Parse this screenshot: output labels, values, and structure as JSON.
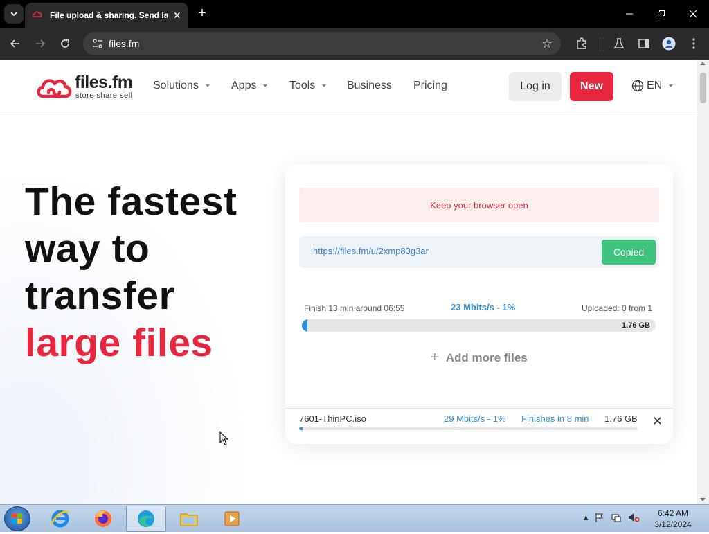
{
  "browser": {
    "tab_title": "File upload & sharing. Send large files",
    "tab_close": "✕",
    "new_tab": "+",
    "url": "files.fm"
  },
  "site": {
    "logo_name": "files.fm",
    "logo_tagline": "store share sell",
    "nav": [
      {
        "label": "Solutions",
        "has_dropdown": true
      },
      {
        "label": "Apps",
        "has_dropdown": true
      },
      {
        "label": "Tools",
        "has_dropdown": true
      },
      {
        "label": "Business",
        "has_dropdown": false
      },
      {
        "label": "Pricing",
        "has_dropdown": false
      }
    ],
    "login_label": "Log in",
    "new_label": "New",
    "language": "EN"
  },
  "hero": {
    "line1": "The fastest",
    "line2": "way to",
    "line3": "transfer",
    "line4_accent": "large files"
  },
  "upload": {
    "warning": "Keep your browser open",
    "share_link": "https://files.fm/u/2xmp83g3ar",
    "copied_label": "Copied",
    "finish_text": "Finish 13 min around 06:55",
    "speed_text": "23 Mbits/s - 1%",
    "uploaded_text": "Uploaded: 0 from 1",
    "total_size": "1.76 GB",
    "progress_fraction": 0.01,
    "add_more_label": "Add more files",
    "file": {
      "name": "7601-ThinPC.iso",
      "speed": "29 Mbits/s - 1%",
      "finishes": "Finishes in 8 min",
      "size": "1.76 GB",
      "progress_fraction": 0.01
    }
  },
  "taskbar": {
    "time": "6:42 AM",
    "date": "3/12/2024"
  },
  "colors": {
    "brand_red": "#e8273f",
    "progress_blue": "#2f8fd8",
    "copied_green": "#3ec47f"
  }
}
